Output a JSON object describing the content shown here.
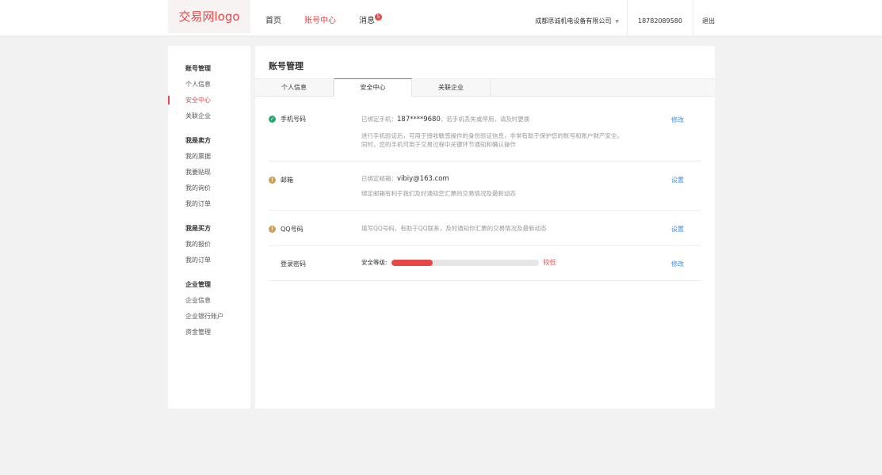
{
  "header": {
    "logo": "交易网logo",
    "nav": [
      {
        "label": "首页"
      },
      {
        "label": "账号中心"
      },
      {
        "label": "消息"
      }
    ],
    "message_count": "5",
    "company": "成都思诚机电设备有限公司",
    "phone": "18782089580",
    "logout": "退出"
  },
  "sidebar": {
    "groups": [
      {
        "title": "账号管理",
        "items": [
          "个人信息",
          "安全中心",
          "关联企业"
        ]
      },
      {
        "title": "我是卖方",
        "items": [
          "我的票据",
          "我要贴现",
          "我的询价",
          "我的订单"
        ]
      },
      {
        "title": "我是买方",
        "items": [
          "我的报价",
          "我的订单"
        ]
      },
      {
        "title": "企业管理",
        "items": [
          "企业信息",
          "企业银行账户",
          "资金管理"
        ]
      }
    ],
    "active_item": "安全中心"
  },
  "main": {
    "title": "账号管理",
    "tabs": [
      "个人信息",
      "安全中心",
      "关联企业"
    ],
    "rows": {
      "phone": {
        "label": "手机号码",
        "prefix": "已绑定手机：",
        "value": "187****9680",
        "suffix": "，若手机丢失或停用，请及时更换",
        "desc1": "进行手机验证后，可用于接收敏感操作的身份验证信息，非常有助于保护您的账号和账户财产安全。",
        "desc2": "同时，您的手机可用于交易过程中关键环节通知和确认操作",
        "action": "修改"
      },
      "email": {
        "label": "邮箱",
        "prefix": "已绑定邮箱：",
        "value": "vibiy@163.com",
        "desc1": "绑定邮箱有利于我们及时通知您汇票的交易情况及最新动态",
        "action": "设置"
      },
      "qq": {
        "label": "QQ号码",
        "desc1": "填写QQ号码，有助于QQ联系，及时通知你汇票的交易情况及最新动态",
        "action": "设置"
      },
      "password": {
        "label": "登录密码",
        "level_label": "安全等级:",
        "level_value": 0.28,
        "level_text": "较低",
        "action": "修改"
      }
    }
  },
  "colors": {
    "accent": "#e84747",
    "link": "#3a8ee6",
    "ok": "#2ba96a",
    "warn": "#c9a15c"
  }
}
